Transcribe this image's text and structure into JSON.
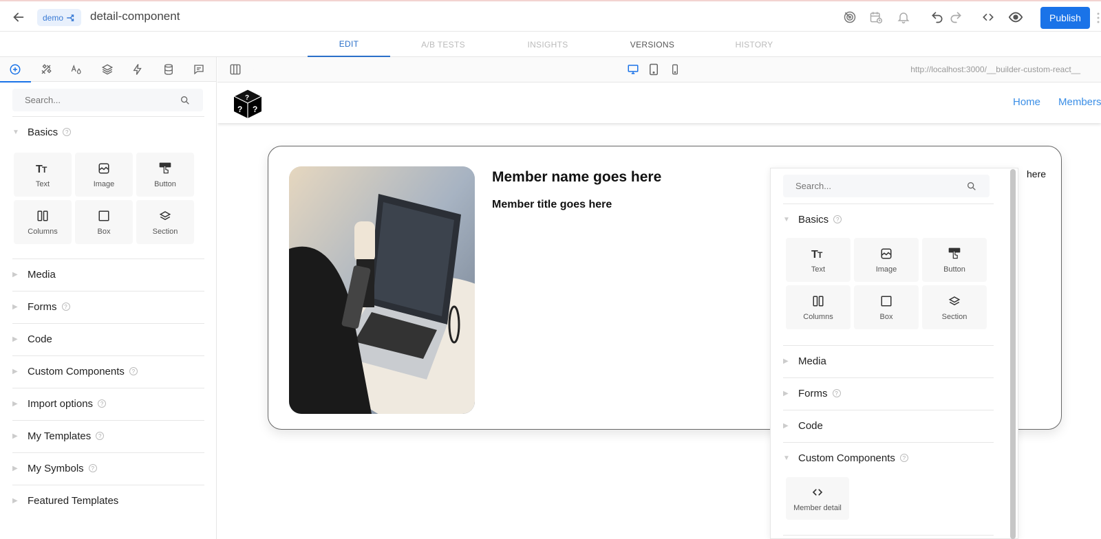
{
  "header": {
    "badge_label": "demo",
    "doc_title": "detail-component",
    "publish_label": "Publish"
  },
  "tabs": [
    {
      "label": "EDIT",
      "state": "active"
    },
    {
      "label": "A/B TESTS",
      "state": "disabled"
    },
    {
      "label": "INSIGHTS",
      "state": "disabled"
    },
    {
      "label": "VERSIONS",
      "state": "normal"
    },
    {
      "label": "HISTORY",
      "state": "disabled"
    }
  ],
  "left_panel": {
    "tab_icons": [
      "add-icon",
      "style-tools-icon",
      "typography-icon",
      "layers-icon",
      "interactions-icon",
      "data-icon",
      "comments-icon"
    ],
    "search_placeholder": "Search...",
    "basics_label": "Basics",
    "blocks": [
      {
        "label": "Text",
        "icon": "text-icon"
      },
      {
        "label": "Image",
        "icon": "image-icon"
      },
      {
        "label": "Button",
        "icon": "button-icon"
      },
      {
        "label": "Columns",
        "icon": "columns-icon"
      },
      {
        "label": "Box",
        "icon": "box-icon"
      },
      {
        "label": "Section",
        "icon": "section-icon"
      }
    ],
    "sections": [
      {
        "label": "Media",
        "help": false
      },
      {
        "label": "Forms",
        "help": true
      },
      {
        "label": "Code",
        "help": false
      },
      {
        "label": "Custom Components",
        "help": true
      },
      {
        "label": "Import options",
        "help": true
      },
      {
        "label": "My Templates",
        "help": true
      },
      {
        "label": "My Symbols",
        "help": true
      },
      {
        "label": "Featured Templates",
        "help": false
      }
    ]
  },
  "canvas_bar": {
    "preview_url": "http://localhost:3000/__builder-custom-react__",
    "active_device": "desktop"
  },
  "site": {
    "nav": [
      "Home",
      "Members"
    ],
    "member_name": "Member name goes here",
    "member_title": "Member title goes here",
    "overflow_text": "here"
  },
  "popover": {
    "search_placeholder": "Search...",
    "basics_label": "Basics",
    "blocks": [
      {
        "label": "Text"
      },
      {
        "label": "Image"
      },
      {
        "label": "Button"
      },
      {
        "label": "Columns"
      },
      {
        "label": "Box"
      },
      {
        "label": "Section"
      }
    ],
    "sections": [
      {
        "label": "Media"
      },
      {
        "label": "Forms"
      },
      {
        "label": "Code"
      },
      {
        "label": "Custom Components"
      }
    ],
    "custom_components": [
      {
        "label": "Member detail"
      }
    ]
  },
  "colors": {
    "accent": "#1a73e8",
    "link": "#3a8ee6"
  }
}
